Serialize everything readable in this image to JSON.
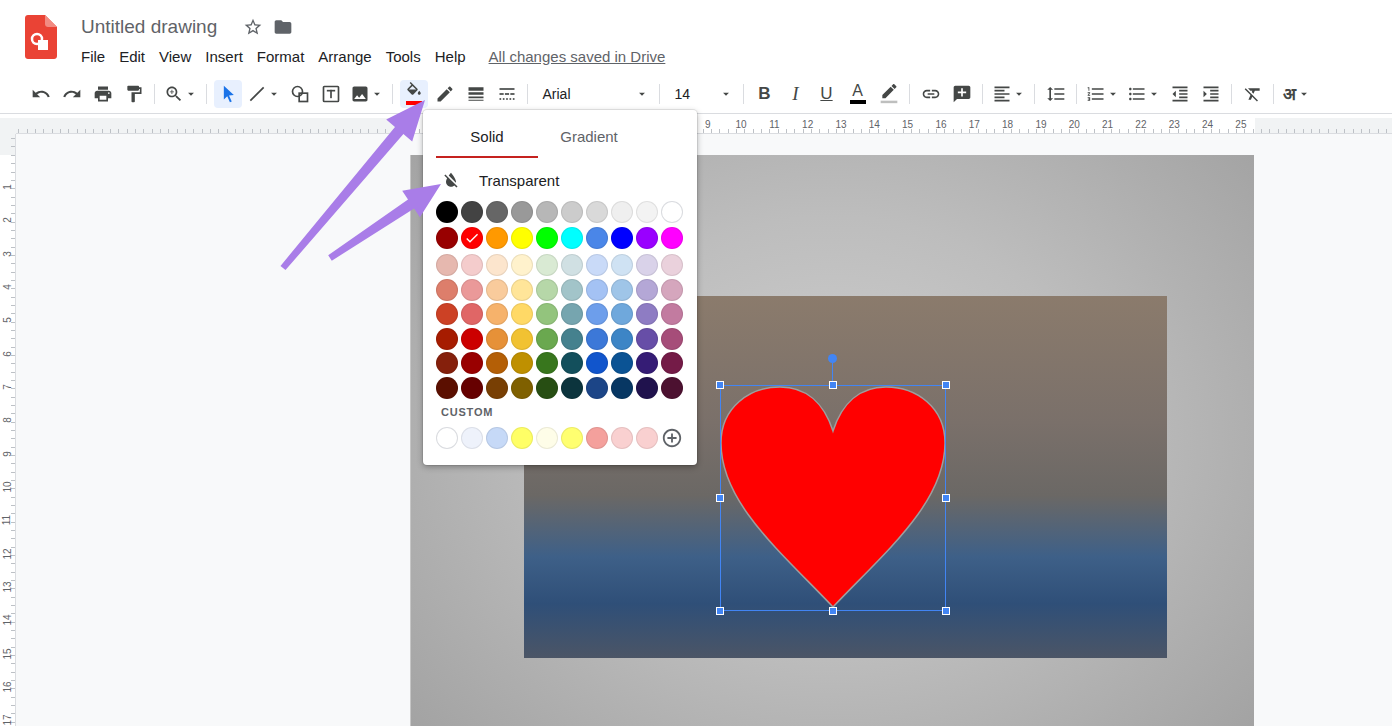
{
  "app": {
    "title": "Untitled drawing",
    "menu": [
      "File",
      "Edit",
      "View",
      "Insert",
      "Format",
      "Arrange",
      "Tools",
      "Help"
    ],
    "save_status": "All changes saved in Drive"
  },
  "toolbar": {
    "groups": [
      [
        {
          "kind": "undo",
          "selected": false,
          "dropdown": false
        },
        {
          "kind": "redo",
          "selected": false,
          "dropdown": false
        },
        {
          "kind": "print",
          "selected": false,
          "dropdown": false
        },
        {
          "kind": "paint-format",
          "selected": false,
          "dropdown": false
        }
      ],
      [
        {
          "kind": "zoom",
          "selected": false,
          "dropdown": true
        }
      ],
      [
        {
          "kind": "select",
          "selected": true,
          "dropdown": false
        },
        {
          "kind": "line",
          "selected": false,
          "dropdown": true
        },
        {
          "kind": "shape",
          "selected": false,
          "dropdown": false
        },
        {
          "kind": "text-box",
          "selected": false,
          "dropdown": false
        },
        {
          "kind": "image",
          "selected": false,
          "dropdown": true
        }
      ],
      [
        {
          "kind": "fill-color",
          "selected": true,
          "dropdown": false,
          "color": "#ff0000"
        },
        {
          "kind": "border-color",
          "selected": false,
          "dropdown": false
        },
        {
          "kind": "border-weight",
          "selected": false,
          "dropdown": false
        },
        {
          "kind": "border-dash",
          "selected": false,
          "dropdown": false
        }
      ],
      [
        {
          "kind": "font",
          "label": "Arial",
          "selected": false,
          "dropdown": true
        }
      ],
      [
        {
          "kind": "font-size",
          "label": "14",
          "selected": false,
          "dropdown": true
        }
      ],
      [
        {
          "kind": "bold",
          "label": "B",
          "selected": false,
          "dropdown": false
        },
        {
          "kind": "italic",
          "label": "I",
          "selected": false,
          "dropdown": false
        },
        {
          "kind": "underline",
          "label": "U",
          "selected": false,
          "dropdown": false
        },
        {
          "kind": "text-color",
          "label": "A",
          "selected": false,
          "dropdown": false,
          "color": "#000000"
        },
        {
          "kind": "highlight",
          "selected": false,
          "dropdown": false
        }
      ],
      [
        {
          "kind": "link",
          "selected": false,
          "dropdown": false
        },
        {
          "kind": "comment",
          "selected": false,
          "dropdown": false
        }
      ],
      [
        {
          "kind": "align",
          "selected": false,
          "dropdown": true
        }
      ],
      [
        {
          "kind": "line-spacing",
          "selected": false,
          "dropdown": false
        }
      ],
      [
        {
          "kind": "numbered-list",
          "selected": false,
          "dropdown": true
        },
        {
          "kind": "bulleted-list",
          "selected": false,
          "dropdown": true
        },
        {
          "kind": "decrease-indent",
          "selected": false,
          "dropdown": false
        },
        {
          "kind": "increase-indent",
          "selected": false,
          "dropdown": false
        }
      ],
      [
        {
          "kind": "clear-formatting",
          "selected": false,
          "dropdown": false
        }
      ],
      [
        {
          "kind": "input-tools",
          "label": "अ",
          "selected": false,
          "dropdown": true
        }
      ]
    ]
  },
  "rulers": {
    "horizontal": [
      "9",
      "10",
      "11",
      "12",
      "13",
      "14",
      "15",
      "16",
      "17",
      "18",
      "19",
      "20",
      "21",
      "22",
      "23",
      "24",
      "25"
    ],
    "vertical": [
      "1",
      "2",
      "3",
      "4",
      "5",
      "6",
      "7",
      "8",
      "9",
      "10",
      "11",
      "12",
      "13",
      "14",
      "15",
      "16",
      "17"
    ]
  },
  "canvas": {
    "shape": {
      "kind": "heart",
      "selected": true
    }
  },
  "fill_menu": {
    "tabs": [
      {
        "label": "Solid",
        "selected": true
      },
      {
        "label": "Gradient",
        "selected": false
      }
    ],
    "transparent": "Transparent",
    "palette": [
      [
        {
          "color": "#000000",
          "selected": false
        },
        {
          "color": "#434343",
          "selected": false
        },
        {
          "color": "#666666",
          "selected": false
        },
        {
          "color": "#999999",
          "selected": false
        },
        {
          "color": "#b7b7b7",
          "selected": false
        },
        {
          "color": "#cccccc",
          "selected": false
        },
        {
          "color": "#d9d9d9",
          "selected": false
        },
        {
          "color": "#efefef",
          "selected": false
        },
        {
          "color": "#f3f3f3",
          "selected": false
        },
        {
          "color": "#ffffff",
          "selected": false
        }
      ],
      [
        {
          "color": "#980000",
          "selected": false
        },
        {
          "color": "#ff0000",
          "selected": true
        },
        {
          "color": "#ff9900",
          "selected": false
        },
        {
          "color": "#ffff00",
          "selected": false
        },
        {
          "color": "#00ff00",
          "selected": false
        },
        {
          "color": "#00ffff",
          "selected": false
        },
        {
          "color": "#4a86e8",
          "selected": false
        },
        {
          "color": "#0000ff",
          "selected": false
        },
        {
          "color": "#9900ff",
          "selected": false
        },
        {
          "color": "#ff00ff",
          "selected": false
        }
      ],
      [
        {
          "color": "#e6b8af",
          "selected": false
        },
        {
          "color": "#f4cccc",
          "selected": false
        },
        {
          "color": "#fce5cd",
          "selected": false
        },
        {
          "color": "#fff2cc",
          "selected": false
        },
        {
          "color": "#d9ead3",
          "selected": false
        },
        {
          "color": "#d0e0e3",
          "selected": false
        },
        {
          "color": "#c9daf8",
          "selected": false
        },
        {
          "color": "#cfe2f3",
          "selected": false
        },
        {
          "color": "#d9d2e9",
          "selected": false
        },
        {
          "color": "#ead1dc",
          "selected": false
        }
      ],
      [
        {
          "color": "#dd7e6b",
          "selected": false
        },
        {
          "color": "#ea9999",
          "selected": false
        },
        {
          "color": "#f9cb9c",
          "selected": false
        },
        {
          "color": "#ffe599",
          "selected": false
        },
        {
          "color": "#b6d7a8",
          "selected": false
        },
        {
          "color": "#a2c4c9",
          "selected": false
        },
        {
          "color": "#a4c2f4",
          "selected": false
        },
        {
          "color": "#9fc5e8",
          "selected": false
        },
        {
          "color": "#b4a7d6",
          "selected": false
        },
        {
          "color": "#d5a6bd",
          "selected": false
        }
      ],
      [
        {
          "color": "#cc4125",
          "selected": false
        },
        {
          "color": "#e06666",
          "selected": false
        },
        {
          "color": "#f6b26b",
          "selected": false
        },
        {
          "color": "#ffd966",
          "selected": false
        },
        {
          "color": "#93c47d",
          "selected": false
        },
        {
          "color": "#76a5af",
          "selected": false
        },
        {
          "color": "#6d9eeb",
          "selected": false
        },
        {
          "color": "#6fa8dc",
          "selected": false
        },
        {
          "color": "#8e7cc3",
          "selected": false
        },
        {
          "color": "#c27ba0",
          "selected": false
        }
      ],
      [
        {
          "color": "#a61c00",
          "selected": false
        },
        {
          "color": "#cc0000",
          "selected": false
        },
        {
          "color": "#e69138",
          "selected": false
        },
        {
          "color": "#f1c232",
          "selected": false
        },
        {
          "color": "#6aa84f",
          "selected": false
        },
        {
          "color": "#45818e",
          "selected": false
        },
        {
          "color": "#3c78d8",
          "selected": false
        },
        {
          "color": "#3d85c6",
          "selected": false
        },
        {
          "color": "#674ea7",
          "selected": false
        },
        {
          "color": "#a64d79",
          "selected": false
        }
      ],
      [
        {
          "color": "#85200c",
          "selected": false
        },
        {
          "color": "#990000",
          "selected": false
        },
        {
          "color": "#b45f06",
          "selected": false
        },
        {
          "color": "#bf9000",
          "selected": false
        },
        {
          "color": "#38761d",
          "selected": false
        },
        {
          "color": "#134f5c",
          "selected": false
        },
        {
          "color": "#1155cc",
          "selected": false
        },
        {
          "color": "#0b5394",
          "selected": false
        },
        {
          "color": "#351c75",
          "selected": false
        },
        {
          "color": "#741b47",
          "selected": false
        }
      ],
      [
        {
          "color": "#5b0f00",
          "selected": false
        },
        {
          "color": "#660000",
          "selected": false
        },
        {
          "color": "#783f04",
          "selected": false
        },
        {
          "color": "#7f6000",
          "selected": false
        },
        {
          "color": "#274e13",
          "selected": false
        },
        {
          "color": "#0c343d",
          "selected": false
        },
        {
          "color": "#1c4587",
          "selected": false
        },
        {
          "color": "#073763",
          "selected": false
        },
        {
          "color": "#20124d",
          "selected": false
        },
        {
          "color": "#4c1130",
          "selected": false
        }
      ]
    ],
    "custom_label": "CUSTOM",
    "custom": [
      {
        "color": "#ffffff",
        "selected": false
      },
      {
        "color": "#eef2fb",
        "selected": false
      },
      {
        "color": "#c6d9f7",
        "selected": false
      },
      {
        "color": "#ffff66",
        "selected": false
      },
      {
        "color": "#fefde8",
        "selected": false
      },
      {
        "color": "#ffff70",
        "selected": false
      },
      {
        "color": "#f4a09c",
        "selected": false
      },
      {
        "color": "#f9d0d0",
        "selected": false
      },
      {
        "color": "#f9d0d0",
        "selected": false
      }
    ]
  }
}
